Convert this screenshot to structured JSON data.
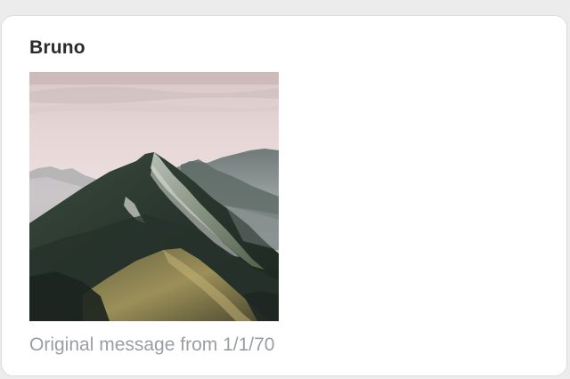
{
  "message": {
    "sender": "Bruno",
    "attachment_icon": "mountain-photo",
    "caption": "Original message from 1/1/70"
  },
  "colors": {
    "background": "#ececec",
    "card": "#ffffff",
    "sender_text": "#2b2b2b",
    "caption_text": "#9a9ea4"
  }
}
